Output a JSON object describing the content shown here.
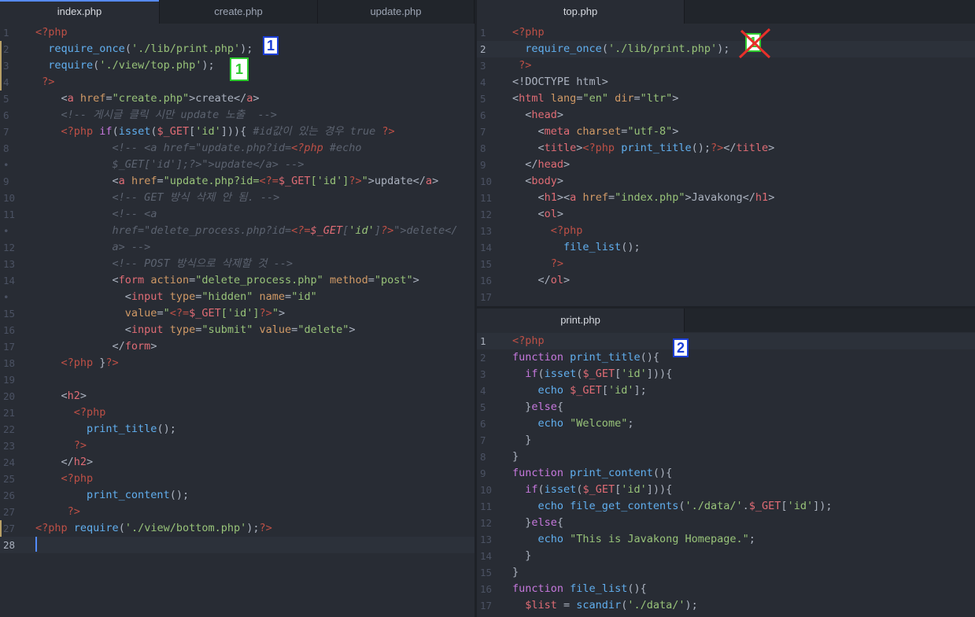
{
  "tabs_left": [
    {
      "label": "index.php",
      "active": true
    },
    {
      "label": "create.php",
      "active": false
    },
    {
      "label": "update.php",
      "active": false
    }
  ],
  "tab_top_right": {
    "label": "top.php"
  },
  "tab_bottom_right": {
    "label": "print.php"
  },
  "left_gutter": [
    "1",
    "2",
    "3",
    "4",
    "5",
    "6",
    "7",
    "8",
    "•",
    "9",
    "10",
    "11",
    "•",
    "12",
    "13",
    "14",
    "•",
    "15",
    "16",
    "17",
    "18",
    "19",
    "20",
    "21",
    "22",
    "23",
    "24",
    "25",
    "26",
    "27",
    "28"
  ],
  "top_gutter": [
    "1",
    "2",
    "3",
    "4",
    "5",
    "6",
    "7",
    "8",
    "9",
    "10",
    "11",
    "12",
    "13",
    "14",
    "15",
    "16",
    "17"
  ],
  "bottom_gutter": [
    "1",
    "2",
    "3",
    "4",
    "5",
    "6",
    "7",
    "8",
    "9",
    "10",
    "11",
    "12",
    "13",
    "14",
    "15",
    "16",
    "17"
  ],
  "badges": {
    "left_blue": "1",
    "left_green": "1",
    "right_green": "1",
    "right_blue": "2"
  },
  "colors": {
    "background": "#282c34",
    "tab_accent": "#568af2",
    "badge_blue": "#1c3fd6",
    "badge_green": "#2ecc2e",
    "cross_red": "#e8302a"
  },
  "icons": {
    "cross": "red-x-icon"
  }
}
